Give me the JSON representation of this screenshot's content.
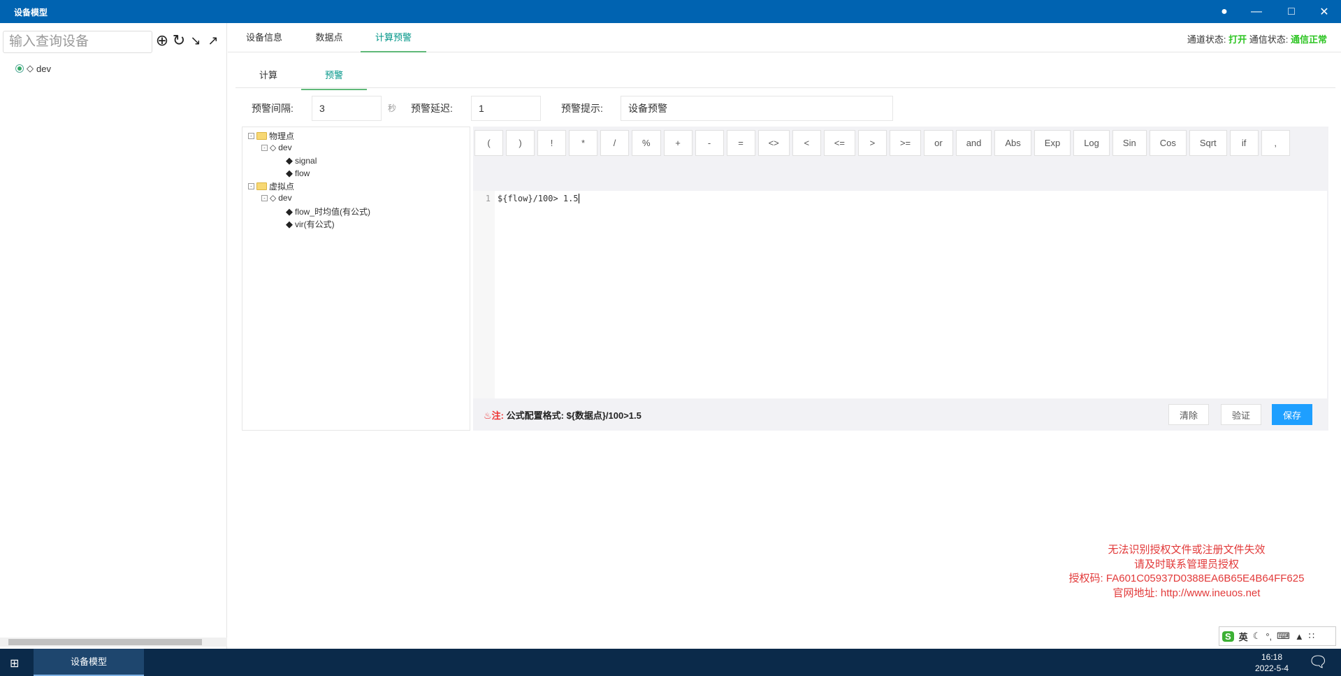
{
  "window": {
    "title": "设备模型",
    "controls": [
      "refresh-icon",
      "minimize-icon",
      "maximize-icon",
      "close-icon"
    ]
  },
  "sidebar": {
    "search_placeholder": "输入查询设备",
    "tools": [
      "add-icon",
      "refresh-icon",
      "import-icon",
      "export-icon"
    ],
    "tree": [
      {
        "label": "dev"
      }
    ]
  },
  "tabs": [
    {
      "label": "设备信息"
    },
    {
      "label": "数据点"
    },
    {
      "label": "计算预警",
      "active": true
    }
  ],
  "status": {
    "channel_label": "通道状态:",
    "channel_value": "打开",
    "comm_label": "通信状态:",
    "comm_value": "通信正常",
    "ok_color": "#2fc525"
  },
  "subtabs": [
    {
      "label": "计算"
    },
    {
      "label": "预警",
      "active": true
    }
  ],
  "form": {
    "interval_label": "预警间隔:",
    "interval_value": "3",
    "interval_unit": "秒",
    "delay_label": "预警延迟:",
    "delay_value": "1",
    "hint_label": "预警提示:",
    "hint_value": "设备预警"
  },
  "tree": {
    "physical": "物理点",
    "physical_dev": "dev",
    "physical_points": [
      "signal",
      "flow"
    ],
    "virtual": "虚拟点",
    "virtual_dev": "dev",
    "virtual_points": [
      "flow_时均值(有公式)",
      "vir(有公式)"
    ]
  },
  "operators": [
    "(",
    ")",
    "!",
    "*",
    "/",
    "%",
    "+",
    "-",
    "=",
    "<>",
    "<",
    "<=",
    ">",
    ">=",
    "or",
    "and",
    "Abs",
    "Exp",
    "Log",
    "Sin",
    "Cos",
    "Sqrt",
    "if",
    ","
  ],
  "editor": {
    "line_number": "1",
    "code": "${flow}/100> 1.5"
  },
  "note": {
    "label": "注:",
    "text": "公式配置格式: ${数据点}/100>1.5"
  },
  "buttons": {
    "clear": "清除",
    "validate": "验证",
    "save": "保存",
    "save_color": "#1e9fff"
  },
  "watermark": [
    "无法识别授权文件或注册文件失效",
    "请及时联系管理员授权",
    "授权码: FA601C05937D0388EA6B65E4B64FF625",
    "官网地址: http://www.ineuos.net"
  ],
  "ime": {
    "lang": "英"
  },
  "taskbar": {
    "app": "设备模型",
    "time": "16:18",
    "date": "2022-5-4"
  }
}
